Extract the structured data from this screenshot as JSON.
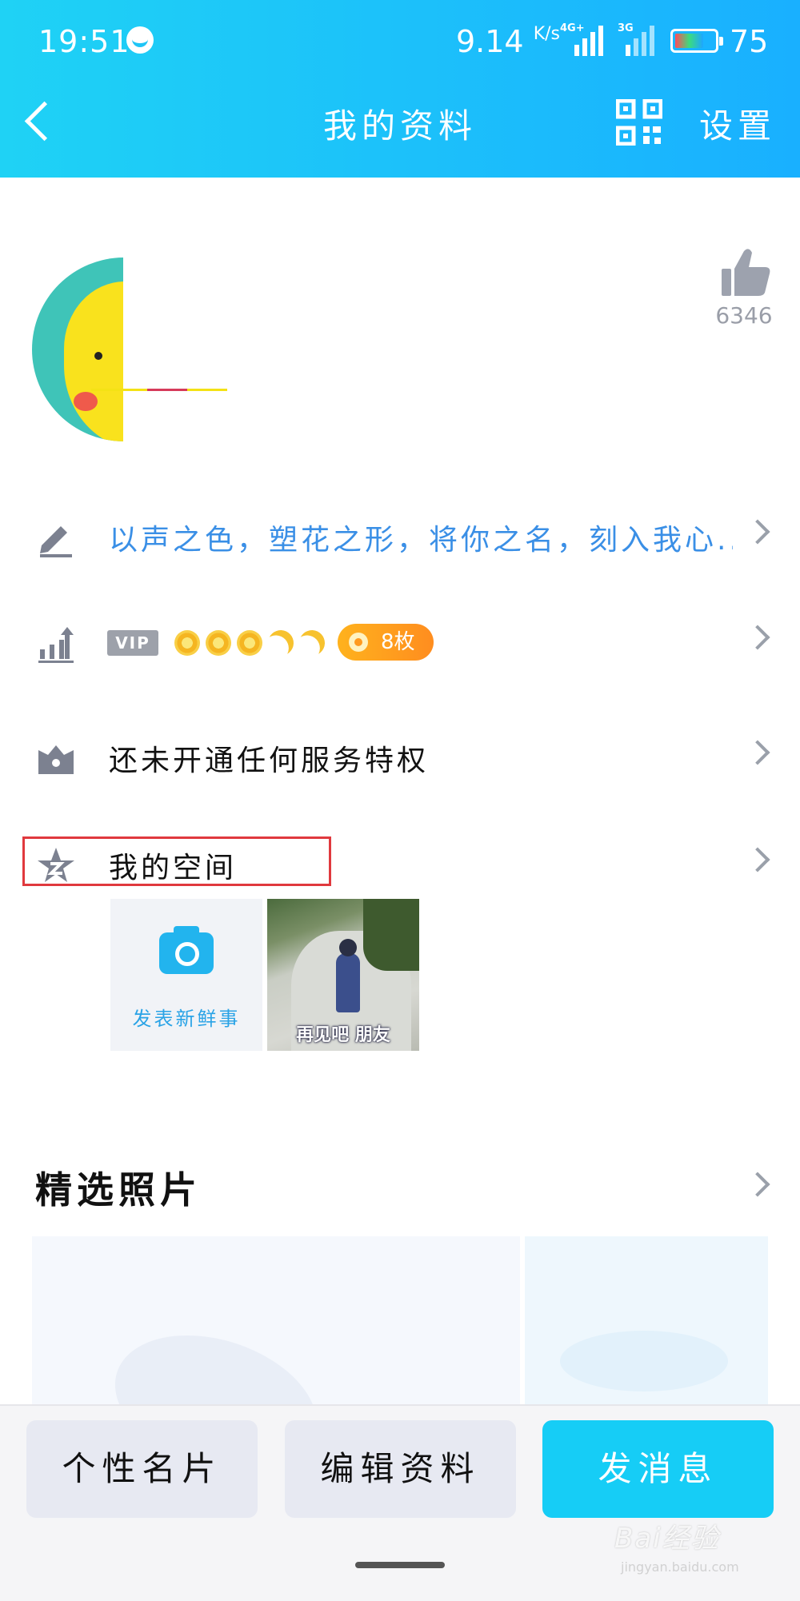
{
  "status_bar": {
    "time": "19:51",
    "speed": "9.14",
    "speed_unit": "K/s",
    "network_1": "4G+",
    "network_2": "3G",
    "battery": "75",
    "battery_level_pct": 75
  },
  "header": {
    "title": "我的资料",
    "settings_label": "设置",
    "qr_icon": "qr-code-icon",
    "back_icon": "back-arrow-icon"
  },
  "profile": {
    "like_count": "6346",
    "like_icon": "thumbs-up-icon"
  },
  "rows": {
    "signature": "以声之色，塑花之形，将你之名，刻入我心...",
    "level": {
      "vip_label": "VIP",
      "medal_label": "8枚"
    },
    "privilege": "还未开通任何服务特权",
    "space": "我的空间"
  },
  "space": {
    "post_label": "发表新鲜事",
    "photo_caption": "再见吧 朋友"
  },
  "featured": {
    "title": "精选照片"
  },
  "bottom": {
    "card_label": "个性名片",
    "edit_label": "编辑资料",
    "message_label": "发消息"
  },
  "watermark": {
    "text": "Bai经验",
    "sub": "jingyan.baidu.com"
  },
  "colors": {
    "header_start": "#1fd2f5",
    "header_end": "#19b0ff",
    "signature_text": "#3a8fe6",
    "primary_button": "#16cdf6",
    "highlight_border": "#e0393e",
    "medal_badge": "#ff9a1f"
  }
}
